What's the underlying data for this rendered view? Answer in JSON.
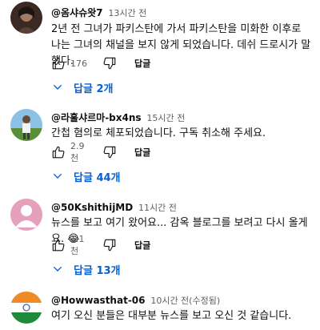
{
  "comments": [
    {
      "handle": "@옴샤슈왓7",
      "time": "13시간 전",
      "text": "2년 전 그녀가 파키스탄에 가서 파키스탄을 미화한 이후로 나는 그녀의 채널을 보지 않게 되었습니다. 데쉬 드로시가 말했다.",
      "likes": "176",
      "reply_label": "답글",
      "replies_label": "답글 2개"
    },
    {
      "handle": "@라훌샤르마-bx4ns",
      "time": "15시간 전",
      "text": "간첩 혐의로 체포되었습니다. 구독 취소해 주세요.",
      "likes": "2.9천",
      "reply_label": "답글",
      "replies_label": "답글 44개"
    },
    {
      "handle": "@50KshithijMD",
      "time": "11시간 전",
      "text": "뉴스를 보고 여기 왔어요... 감옥 블로그를 보려고 다시 올게요. 😂",
      "likes": "1.1천",
      "reply_label": "답글",
      "replies_label": "답글 13개"
    },
    {
      "handle": "@Howwasthat-06",
      "time": "10시간 전(수정됨)",
      "text": "여기 오신 분들은 대부분 뉴스를 보고 오신 것 같습니다."
    }
  ],
  "colors": {
    "link_blue": "#065fd4",
    "secondary_text": "#606060",
    "default_avatar": "#e5a0bc"
  }
}
